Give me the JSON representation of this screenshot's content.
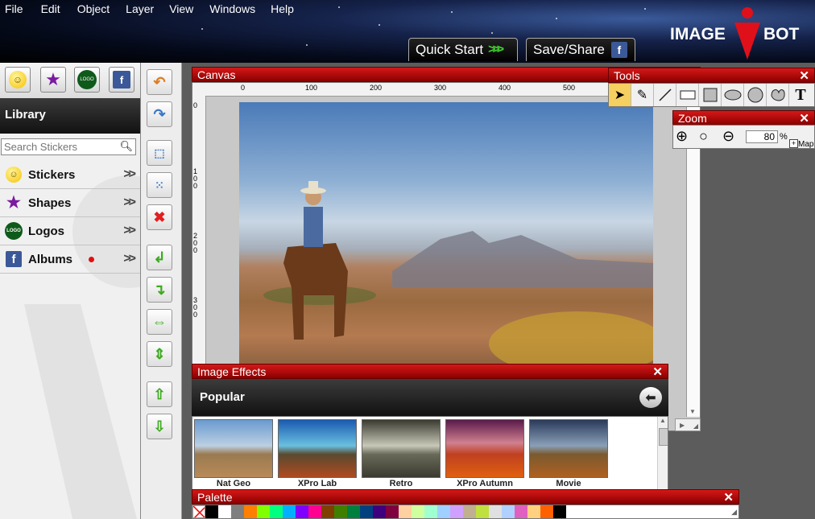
{
  "menu": [
    "File",
    "Edit",
    "Object",
    "Layer",
    "View",
    "Windows",
    "Help"
  ],
  "top_buttons": {
    "quick_start": "Quick Start",
    "save_share": "Save/Share"
  },
  "logo": {
    "left": "IMAGE",
    "right": "BOT"
  },
  "library": {
    "title": "Library",
    "search_placeholder": "Search Stickers",
    "items": [
      {
        "label": "Stickers",
        "icon": "smiley-icon"
      },
      {
        "label": "Shapes",
        "icon": "star-shape-icon"
      },
      {
        "label": "Logos",
        "icon": "logo-icon"
      },
      {
        "label": "Albums",
        "icon": "facebook-icon"
      }
    ],
    "chevron": ">>"
  },
  "canvas": {
    "title": "Canvas",
    "ruler_top": [
      "0",
      "100",
      "200",
      "300",
      "400",
      "500"
    ],
    "ruler_left": [
      "0",
      "100",
      "200",
      "300"
    ]
  },
  "tools_panel": {
    "title": "Tools"
  },
  "zoom_panel": {
    "title": "Zoom",
    "value": "80",
    "unit": "%",
    "map_label": "Map"
  },
  "image_effects": {
    "title": "Image Effects",
    "category": "Popular",
    "effects": [
      "Nat Geo",
      "XPro Lab",
      "Retro",
      "XPro Autumn",
      "Movie"
    ]
  },
  "palette": {
    "title": "Palette",
    "colors": [
      "#000000",
      "#ffffff",
      "#7f7f7f",
      "#ff7f00",
      "#7fff00",
      "#00ff7f",
      "#00b0ff",
      "#7f00ff",
      "#ff0090",
      "#7f3f00",
      "#3f7f00",
      "#007f3f",
      "#00407f",
      "#3f007f",
      "#7f003f",
      "#ffd0a0",
      "#d0ffa0",
      "#a0ffd0",
      "#a0d0ff",
      "#d0a0ff",
      "#c0b090",
      "#c0e040",
      "#e0e0e0",
      "#b0d0ff",
      "#e060c0",
      "#ffd080",
      "#ff6000",
      "#000000"
    ]
  }
}
